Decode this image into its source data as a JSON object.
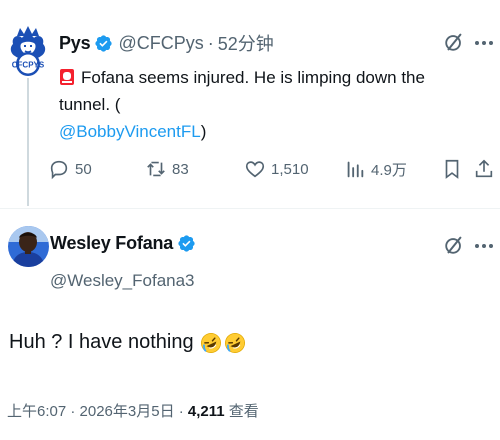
{
  "tweet1": {
    "author_name": "Pys",
    "author_handle": "@CFCPys",
    "separator": "·",
    "time": "52分钟",
    "text": "Fofana seems injured. He is limping down the tunnel. (",
    "mention": "@BobbyVincentFL",
    "text_end": ")",
    "stats": {
      "replies": "50",
      "reposts": "83",
      "likes": "1,510",
      "views": "4.9万"
    }
  },
  "tweet2": {
    "author_name": "Wesley Fofana",
    "author_handle": "@Wesley_Fofana3",
    "text": "Huh ? I have nothing",
    "timestamp": "上午6:07 · 2026年3月5日 · ",
    "view_count": "4,211",
    "view_label": " 查看"
  },
  "avatars": {
    "pys_logo_text": "CFCPYS"
  },
  "icons": [
    "verified-icon",
    "grok-icon",
    "more-icon",
    "reply-icon",
    "repost-icon",
    "like-icon",
    "views-icon",
    "bookmark-icon",
    "share-icon",
    "siren-icon",
    "rofl-emoji-icon"
  ],
  "colors": {
    "verified": "#1d9bf0",
    "link": "#1d9bf0",
    "secondary_text": "#536471",
    "primary_text": "#0f1419"
  }
}
